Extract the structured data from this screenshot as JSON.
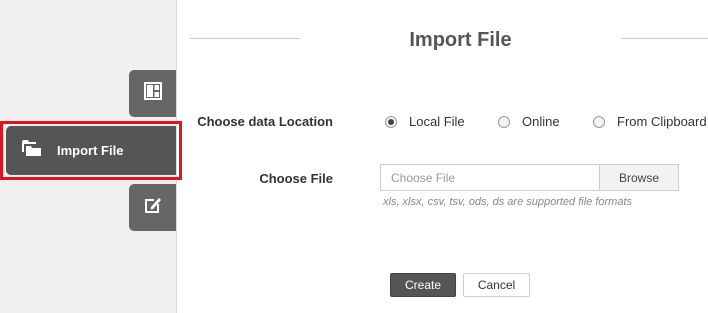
{
  "sidebar": {
    "tabs": [
      {
        "icon": "layout-icon"
      },
      {
        "label": "Import File",
        "icon": "folders-icon",
        "active": true
      },
      {
        "icon": "edit-icon"
      }
    ]
  },
  "page": {
    "title": "Import File"
  },
  "form": {
    "location_label": "Choose data Location",
    "location_options": [
      "Local File",
      "Online",
      "From Clipboard"
    ],
    "selected_location": "Local File",
    "file_label": "Choose File",
    "file_placeholder": "Choose File",
    "file_value": "",
    "browse_label": "Browse",
    "hint": "xls, xlsx, csv, tsv, ods, ds are supported file formats",
    "create_label": "Create",
    "cancel_label": "Cancel"
  },
  "colors": {
    "highlight": "#e0141e",
    "tab": "#666666",
    "active_tab": "#555555",
    "primary_button": "#555555"
  }
}
